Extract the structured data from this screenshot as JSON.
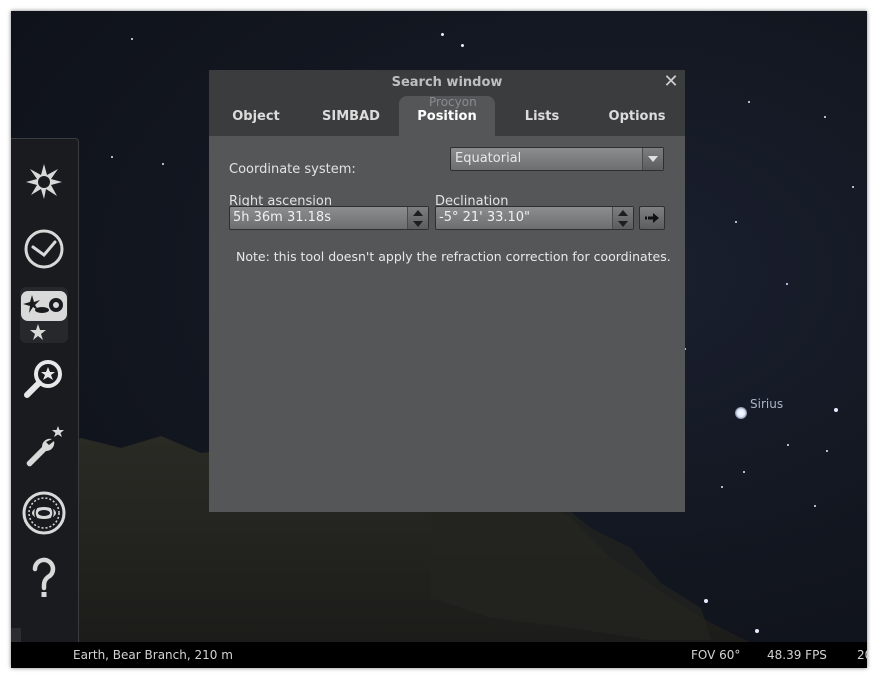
{
  "sky": {
    "labels": [
      {
        "id": "sirius",
        "text": "Sirius"
      }
    ]
  },
  "toolbar": {
    "items": [
      {
        "name": "sky-and-viewing-options-icon"
      },
      {
        "name": "date-time-clock-icon"
      },
      {
        "name": "sky-culture-deep-sky-icon"
      },
      {
        "name": "search-magnifier-icon"
      },
      {
        "name": "configuration-wrench-icon"
      },
      {
        "name": "location-globe-icon"
      },
      {
        "name": "help-question-icon"
      }
    ]
  },
  "dialog": {
    "title": "Search window",
    "close_glyph": "✕",
    "ghost_label": "Procyon",
    "tabs": [
      {
        "label": "Object",
        "active": false
      },
      {
        "label": "SIMBAD",
        "active": false
      },
      {
        "label": "Position",
        "active": true
      },
      {
        "label": "Lists",
        "active": false
      },
      {
        "label": "Options",
        "active": false
      }
    ],
    "coordinate_system_label": "Coordinate system:",
    "coordinate_system_value": "Equatorial",
    "right_ascension_label": "Right ascension",
    "right_ascension_value": "5h 36m 31.18s",
    "declination_label": "Declination",
    "declination_value": "-5° 21' 33.10\"",
    "note": "Note: this tool doesn't apply the refraction correction for coordinates."
  },
  "status_bar": {
    "location": "Earth, Bear Branch, 210 m",
    "fov": "FOV 60°",
    "fps": "48.39 FPS",
    "date_partial": "20"
  },
  "colors": {
    "sky": "#12161f",
    "dialog_bg": "#555657",
    "dialog_header": "#3b3c3e",
    "toolbar_bg": "#1a1b1e"
  }
}
